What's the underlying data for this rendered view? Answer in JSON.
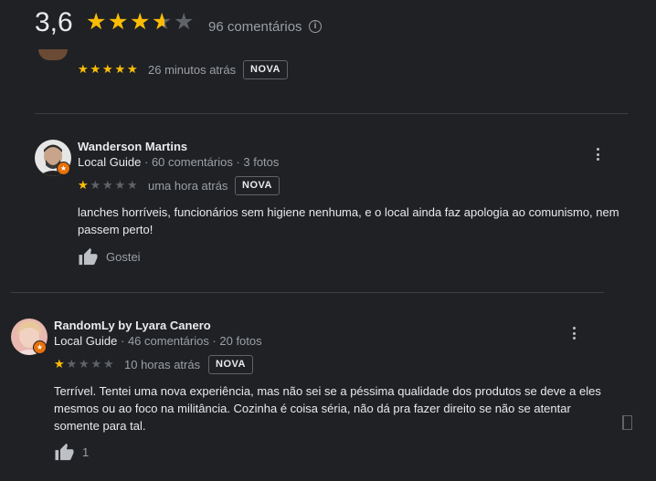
{
  "summary": {
    "rating": "3,6",
    "rating_value": 3.6,
    "count_text": "96 comentários",
    "info_icon": "info-icon"
  },
  "colors": {
    "star": "#fbbc04",
    "star_empty": "#5f6368",
    "background": "#202124",
    "local_guide_badge": "#e8710a"
  },
  "reviews": [
    {
      "stars": 5,
      "time": "26 minutos atrás",
      "badge": "NOVA"
    },
    {
      "name": "Wanderson Martins",
      "local_guide": "Local Guide",
      "meta": " · 60 comentários · 3 fotos",
      "stars": 1,
      "time": "uma hora atrás",
      "badge": "NOVA",
      "text": "lanches horríveis, funcionários sem higiene nenhuma, e o local ainda faz apologia ao comunismo, nem passem perto!",
      "like_label": "Gostei"
    },
    {
      "name": "RandomLy by Lyara Canero",
      "local_guide": "Local Guide",
      "meta": " · 46 comentários · 20 fotos",
      "stars": 1,
      "time": "10 horas atrás",
      "badge": "NOVA",
      "text": "Terrível. Tentei uma nova experiência, mas não sei se a péssima qualidade dos produtos se deve a eles mesmos ou ao foco na militância. Cozinha é coisa séria, não dá pra fazer direito se não se atentar somente para tal.",
      "like_label": "1"
    }
  ]
}
